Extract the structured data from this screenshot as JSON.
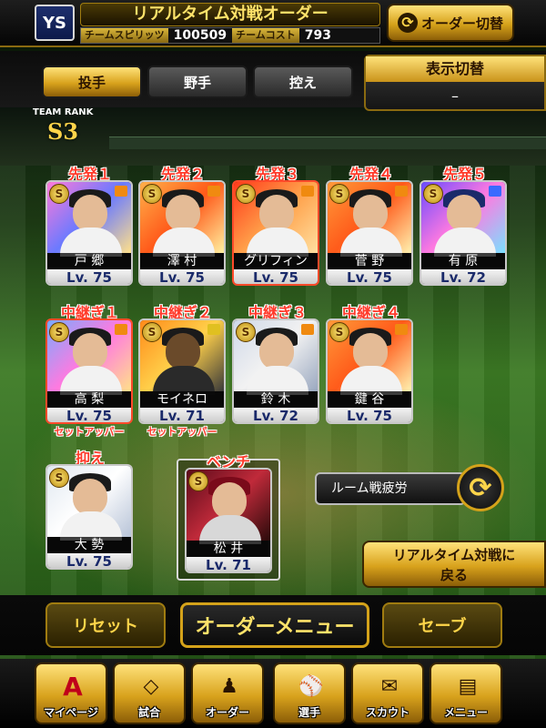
{
  "header": {
    "team_logo": "YS",
    "title": "リアルタイム対戦オーダー",
    "spirits_label": "チームスピリッツ",
    "spirits_value": "100509",
    "cost_label": "チームコスト",
    "cost_value": "793",
    "order_switch_label": "オーダー切替"
  },
  "tabs": [
    {
      "label": "投手",
      "active": true
    },
    {
      "label": "野手",
      "active": false
    },
    {
      "label": "控え",
      "active": false
    }
  ],
  "display_toggle": {
    "label": "表示切替",
    "value": "–"
  },
  "team_rank": {
    "label": "TEAM RANK",
    "value": "S3"
  },
  "starters": [
    {
      "slot": "先発１",
      "name": "戸 郷",
      "level": "Lv. 75"
    },
    {
      "slot": "先発２",
      "name": "澤 村",
      "level": "Lv. 75"
    },
    {
      "slot": "先発３",
      "name": "グリフィン",
      "level": "Lv. 75"
    },
    {
      "slot": "先発４",
      "name": "菅 野",
      "level": "Lv. 75"
    },
    {
      "slot": "先発５",
      "name": "有 原",
      "level": "Lv. 72"
    }
  ],
  "relievers": [
    {
      "slot": "中継ぎ１",
      "name": "高 梨",
      "level": "Lv. 75",
      "role": "セットアッパー"
    },
    {
      "slot": "中継ぎ２",
      "name": "モイネロ",
      "level": "Lv. 71",
      "role": "セットアッパー"
    },
    {
      "slot": "中継ぎ３",
      "name": "鈴 木",
      "level": "Lv. 72",
      "role": ""
    },
    {
      "slot": "中継ぎ４",
      "name": "鍵 谷",
      "level": "Lv. 75",
      "role": ""
    }
  ],
  "closer": {
    "slot": "抑え",
    "name": "大 勢",
    "level": "Lv. 75"
  },
  "bench": {
    "slot": "ベンチ",
    "name": "松 井",
    "level": "Lv. 71"
  },
  "fatigue_label": "ルーム戦疲労",
  "back_button": {
    "line1": "リアルタイム対戦に",
    "line2": "戻る"
  },
  "actions": {
    "reset": "リセット",
    "menu": "オーダーメニュー",
    "save": "セーブ"
  },
  "nav": [
    {
      "label": "マイページ",
      "icon": "A"
    },
    {
      "label": "試合",
      "icon": "◇"
    },
    {
      "label": "オーダー",
      "icon": "♟"
    },
    {
      "label": "選手",
      "icon": "⚾"
    },
    {
      "label": "スカウト",
      "icon": "✉"
    },
    {
      "label": "メニュー",
      "icon": "▤"
    }
  ],
  "colors": {
    "gold": "#d8a21c",
    "slot_red": "#ff3a2a",
    "level_blue": "#1a2a6a"
  }
}
